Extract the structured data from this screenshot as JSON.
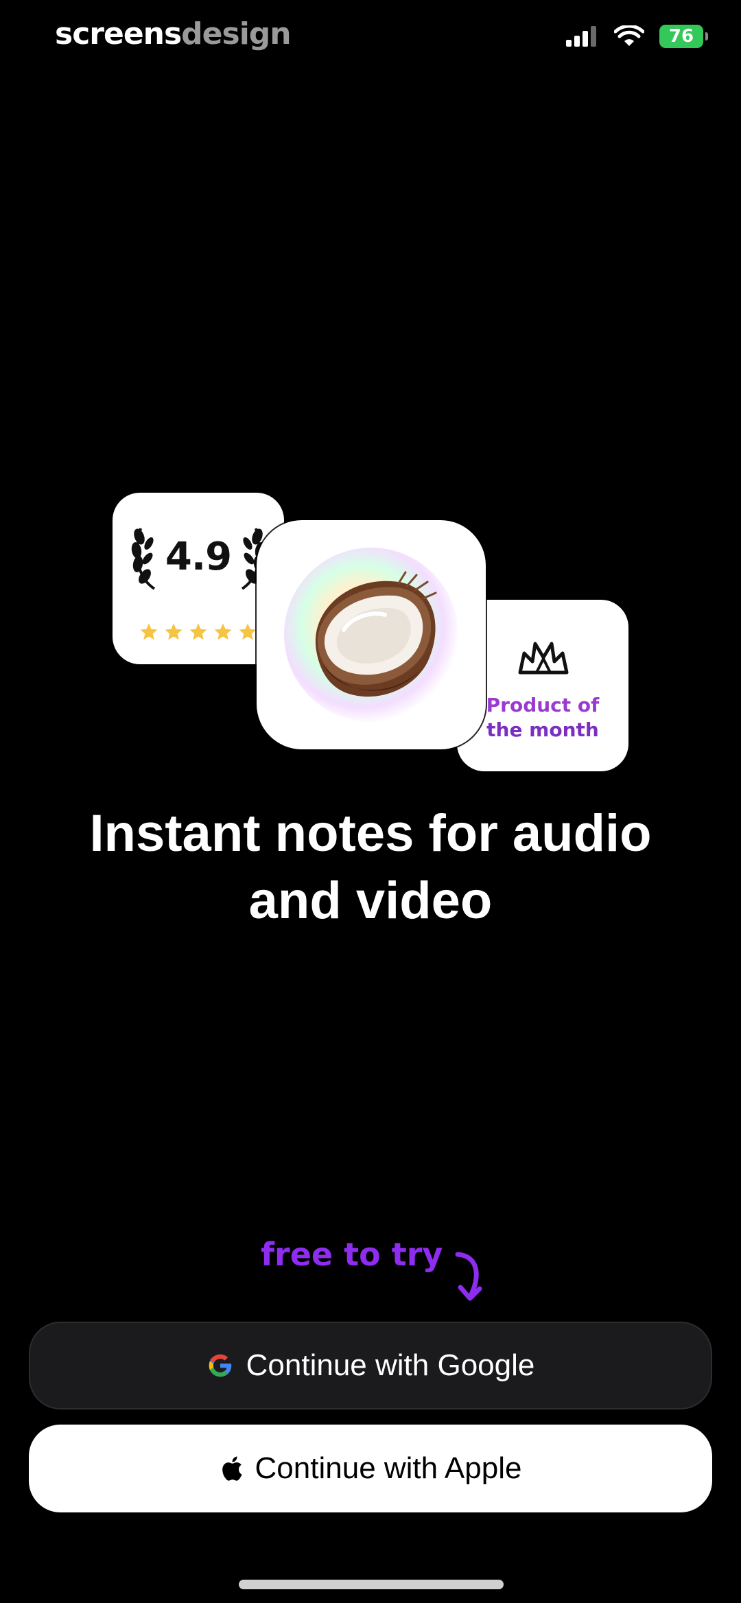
{
  "status_bar": {
    "watermark_part1": "screens",
    "watermark_part2": "design",
    "battery": "76"
  },
  "hero": {
    "rating_value": "4.9",
    "star_count": 5,
    "award_line1": "Product of",
    "award_line2": "the month",
    "app_icon": "coconut-icon"
  },
  "headline": "Instant notes for audio and video",
  "free_to_try": "free to try",
  "buttons": {
    "google_label": "Continue with Google",
    "apple_label": "Continue with Apple"
  },
  "colors": {
    "accent_purple": "#8e2df0",
    "battery_green": "#34c759",
    "star_yellow": "#f5c442"
  }
}
